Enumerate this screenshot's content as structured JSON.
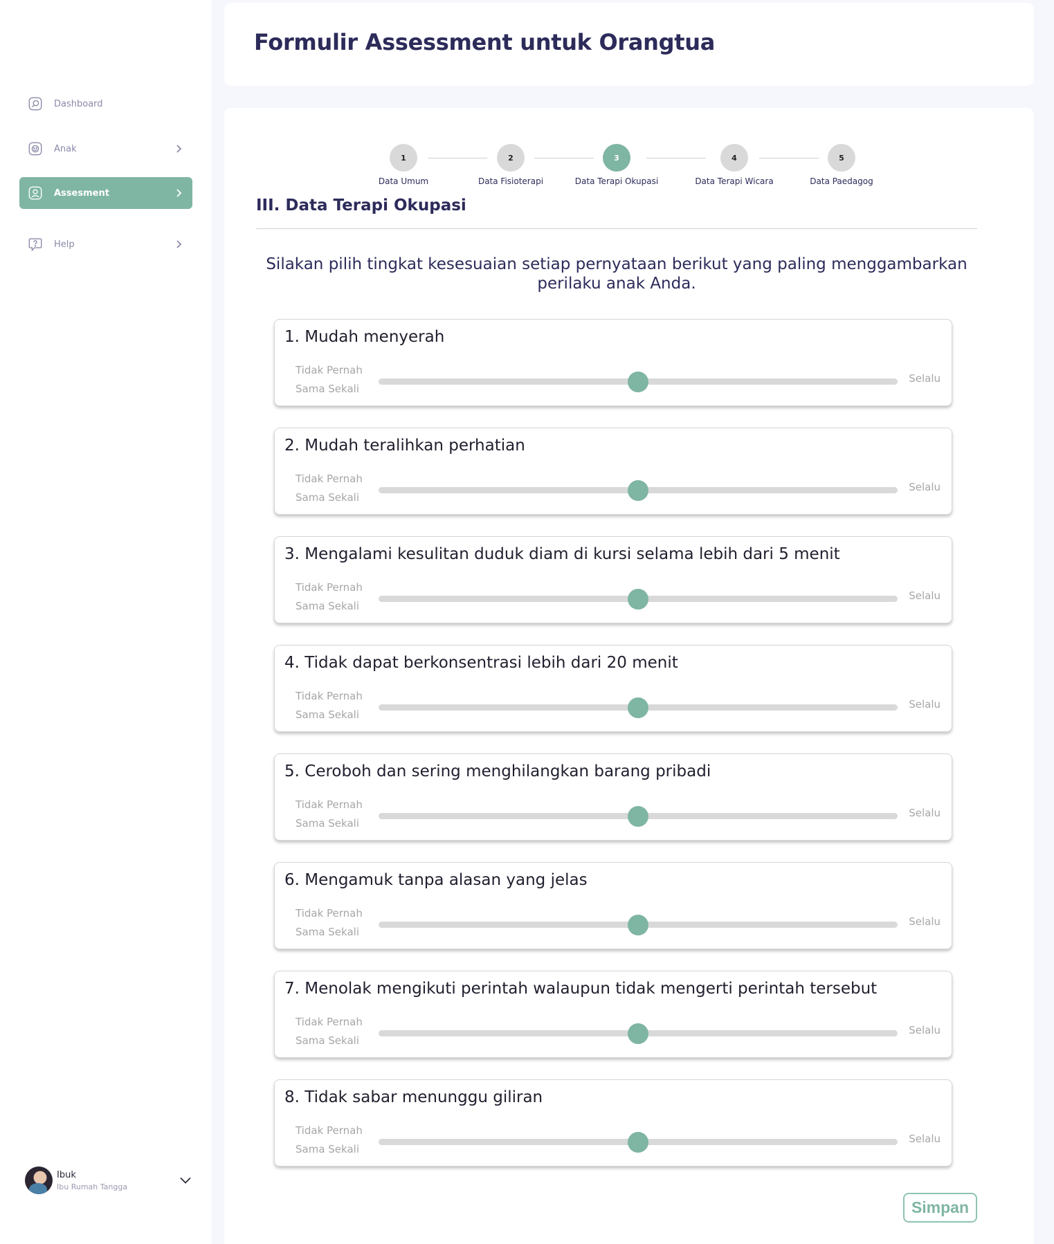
{
  "sidebar": {
    "items": [
      {
        "label": "Dashboard",
        "icon": "dashboard-icon",
        "active": false,
        "has_chevron": false
      },
      {
        "label": "Anak",
        "icon": "child-icon",
        "active": false,
        "has_chevron": true
      },
      {
        "label": "Assesment",
        "icon": "assessment-icon",
        "active": true,
        "has_chevron": true
      },
      {
        "label": "Help",
        "icon": "help-icon",
        "active": false,
        "has_chevron": true
      }
    ],
    "profile": {
      "name": "Ibuk",
      "role": "Ibu Rumah Tangga"
    }
  },
  "header": {
    "title": "Formulir Assessment untuk Orangtua"
  },
  "stepper": {
    "current": 3,
    "steps": [
      {
        "number": "1",
        "label": "Data Umum"
      },
      {
        "number": "2",
        "label": "Data Fisioterapi"
      },
      {
        "number": "3",
        "label": "Data Terapi Okupasi"
      },
      {
        "number": "4",
        "label": "Data Terapi Wicara"
      },
      {
        "number": "5",
        "label": "Data Paedagog"
      }
    ]
  },
  "section": {
    "title": "III. Data Terapi Okupasi",
    "instruction": "Silakan pilih tingkat kesesuaian setiap pernyataan berikut yang paling menggambarkan perilaku anak Anda."
  },
  "scale": {
    "min_label": "Tidak Pernah Sama Sekali",
    "max_label": "Selalu"
  },
  "questions": [
    {
      "text": "1. Mudah menyerah",
      "value": 0.5
    },
    {
      "text": "2. Mudah teralihkan perhatian",
      "value": 0.5
    },
    {
      "text": "3. Mengalami kesulitan duduk diam di kursi selama lebih dari 5 menit",
      "value": 0.5
    },
    {
      "text": "4. Tidak dapat berkonsentrasi lebih dari 20 menit",
      "value": 0.5
    },
    {
      "text": "5. Ceroboh dan sering menghilangkan barang pribadi",
      "value": 0.5
    },
    {
      "text": "6. Mengamuk tanpa alasan yang jelas",
      "value": 0.5
    },
    {
      "text": "7. Menolak mengikuti perintah walaupun tidak mengerti perintah tersebut",
      "value": 0.5
    },
    {
      "text": "8. Tidak sabar menunggu giliran",
      "value": 0.5
    }
  ],
  "actions": {
    "save_label": "Simpan"
  },
  "colors": {
    "accent": "#7fb5a3",
    "title": "#2c2b5a",
    "track": "#d9d9d9"
  }
}
